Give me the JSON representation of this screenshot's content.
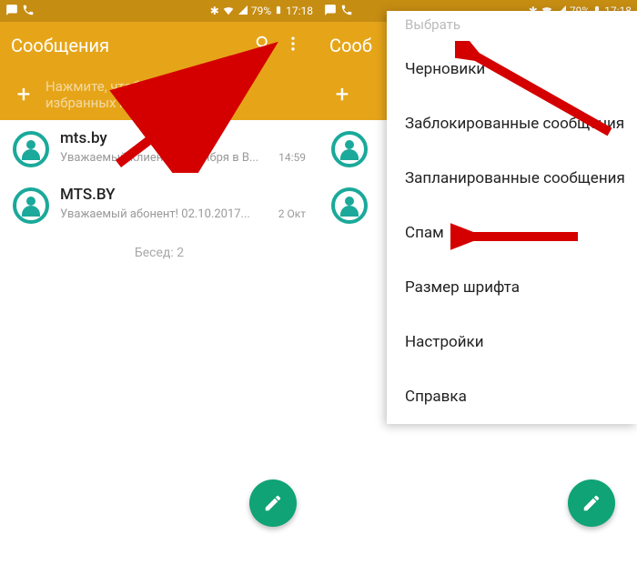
{
  "status": {
    "time": "17:18",
    "battery_pct": "79%"
  },
  "appbar": {
    "title": "Сообщения"
  },
  "subhead": {
    "line1": "Нажмите, чтобы добавить",
    "line2": "избранных получателей",
    "truncated": "Нажмите, чтобы добав\nизбранных получател",
    "right_truncated": "Сооб"
  },
  "conversations": [
    {
      "name": "mts.by",
      "preview": "Уважаемый клиент! 2 октября в В...",
      "time": "14:59"
    },
    {
      "name": "MTS.BY",
      "preview": "Уважаемый абонент! 02.10.2017...",
      "time": "2 Окт"
    }
  ],
  "footer": "Бесед: 2",
  "menu": {
    "top": "Выбрать",
    "items": [
      "Черновики",
      "Заблокированные сообщения",
      "Запланированные сообщения",
      "Спам",
      "Размер шрифта",
      "Настройки",
      "Справка"
    ]
  }
}
